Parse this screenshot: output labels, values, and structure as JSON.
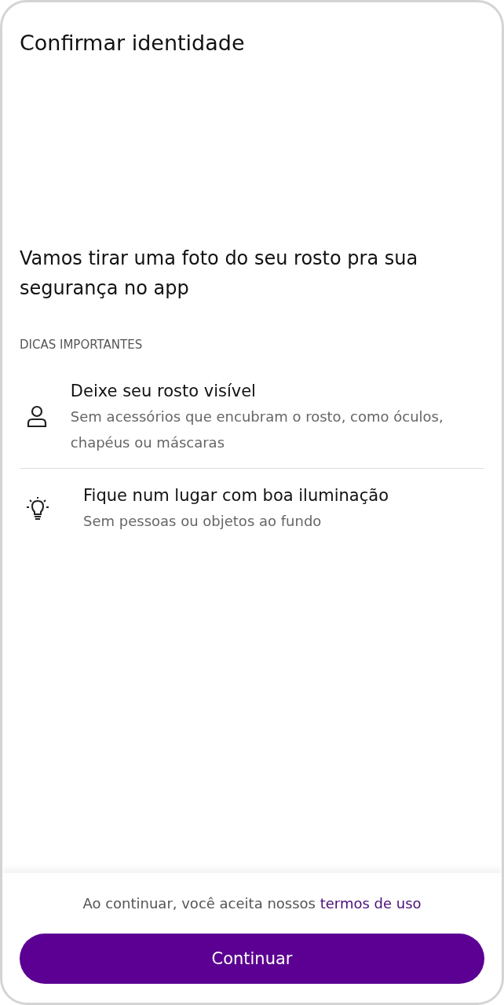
{
  "header": {
    "title": "Confirmar identidade"
  },
  "intro": "Vamos tirar uma foto do seu rosto pra sua segurança no app",
  "tips": {
    "heading": "DICAS IMPORTANTES",
    "items": [
      {
        "kind": "person",
        "title": "Deixe seu rosto visível",
        "description": "Sem acessórios que encubram o rosto, como óculos, chapéus ou máscaras"
      },
      {
        "kind": "bulb",
        "title": "Fique num lugar com boa iluminação",
        "description": "Sem pessoas ou objetos ao fundo"
      }
    ]
  },
  "footer": {
    "consent_text": "Ao continuar, você aceita nossos",
    "terms_link": "termos de uso",
    "button": "Continuar"
  }
}
